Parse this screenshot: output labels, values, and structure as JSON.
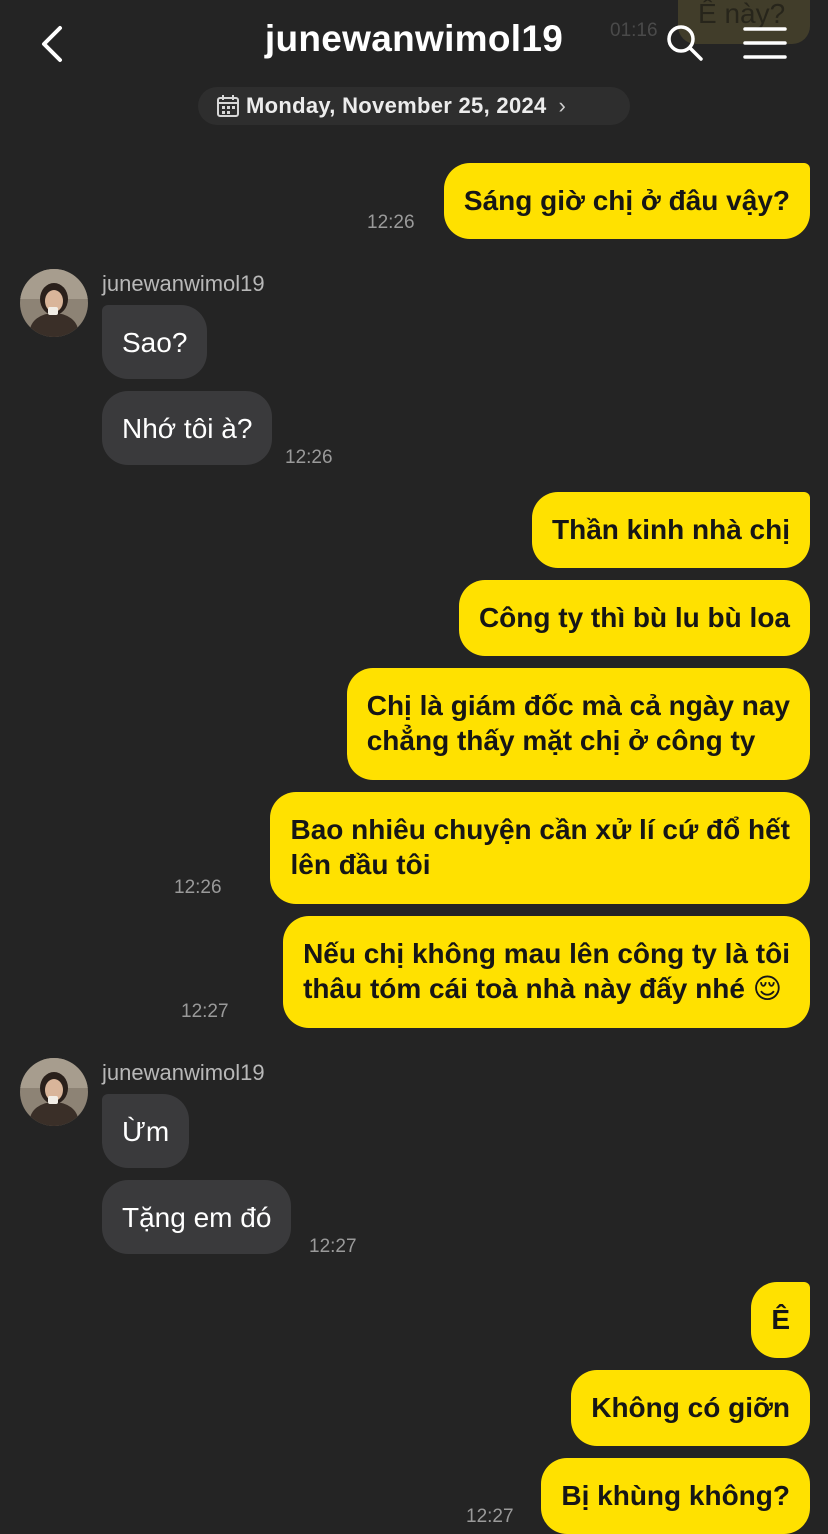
{
  "header": {
    "title": "junewanwimol19",
    "ghost_message": "Ê này?",
    "ghost_time": "01:16",
    "date": "Monday, November 25, 2024"
  },
  "colors": {
    "background": "#242424",
    "outgoing_bubble": "#ffe100",
    "incoming_bubble": "#3a3a3c",
    "timestamp": "#9a9a9a"
  },
  "messages": [
    {
      "dir": "out",
      "lines": [
        "Sáng giờ chị ở đâu vậy?"
      ],
      "time": "12:26"
    },
    {
      "dir": "in",
      "sender": "junewanwimol19",
      "lines": [
        "Sao?"
      ]
    },
    {
      "dir": "in",
      "lines": [
        "Nhớ tôi à?"
      ],
      "time": "12:26"
    },
    {
      "dir": "out",
      "lines": [
        "Thần kinh nhà chị"
      ]
    },
    {
      "dir": "out",
      "lines": [
        "Công ty thì bù lu bù loa"
      ]
    },
    {
      "dir": "out",
      "lines": [
        "Chị là giám đốc mà cả ngày nay",
        "chẳng thấy mặt chị ở công ty"
      ]
    },
    {
      "dir": "out",
      "lines": [
        "Bao nhiêu chuyện cần xử lí cứ đổ hết",
        "lên đầu tôi"
      ],
      "time": "12:26"
    },
    {
      "dir": "out",
      "lines": [
        "Nếu chị không mau lên công ty là tôi",
        "thâu tóm cái toà nhà này đấy nhé 😌"
      ],
      "time": "12:27"
    },
    {
      "dir": "in",
      "sender": "junewanwimol19",
      "lines": [
        "Ừm"
      ]
    },
    {
      "dir": "in",
      "lines": [
        "Tặng em đó"
      ],
      "time": "12:27"
    },
    {
      "dir": "out",
      "lines": [
        "Ê"
      ]
    },
    {
      "dir": "out",
      "lines": [
        "Không có giỡn"
      ]
    },
    {
      "dir": "out",
      "lines": [
        "Bị khùng không?"
      ],
      "time": "12:27"
    }
  ]
}
